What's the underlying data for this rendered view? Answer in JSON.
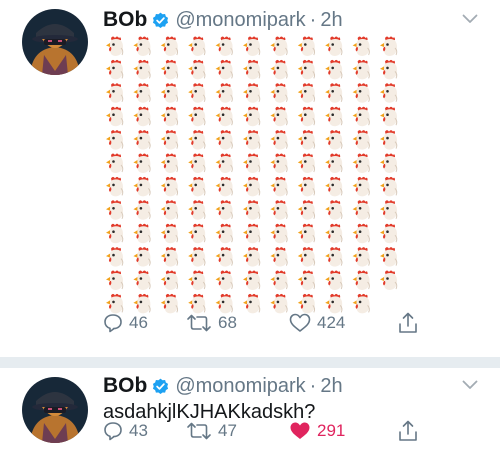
{
  "tweets": [
    {
      "author_name": "BOb",
      "handle": "@monomipark",
      "separator": "·",
      "time": "2h",
      "content_emoji": "chicken-head-emoji",
      "emoji_rows": [
        11,
        11,
        11,
        11,
        11,
        11,
        11,
        11,
        11,
        11,
        11,
        10
      ],
      "reply_count": "46",
      "retweet_count": "68",
      "like_count": "424",
      "liked": false
    },
    {
      "author_name": "BOb",
      "handle": "@monomipark",
      "separator": "·",
      "time": "2h",
      "text": "asdahkjlKJHAKkadskh?",
      "reply_count": "43",
      "retweet_count": "47",
      "like_count": "291",
      "liked": true
    }
  ],
  "colors": {
    "verified": "#1da1f2",
    "muted": "#657786",
    "like_active": "#e0245e",
    "divider": "#e6ecf0"
  }
}
